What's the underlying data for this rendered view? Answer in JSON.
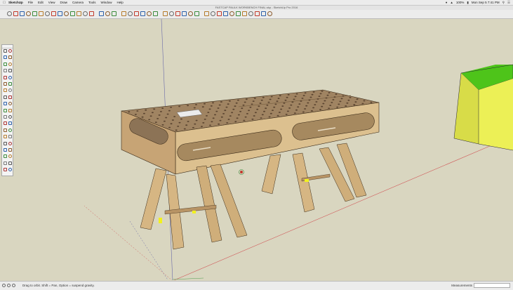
{
  "menubar": {
    "app": "SketchUp",
    "items": [
      "File",
      "Edit",
      "View",
      "Draw",
      "Camera",
      "Tools",
      "Window",
      "Help"
    ],
    "battery": "100%",
    "clock": "Mon Sep 5  7:41 PM"
  },
  "window": {
    "title": "FASTCAP PAULK WORKBENCH FINAL.skp - SketchUp Pro 2016"
  },
  "status": {
    "hint": "Drag to orbit. Shift = Pan, Option = suspend gravity.",
    "measurements_label": "Measurements"
  },
  "colors": {
    "sky": "#d9d6c0",
    "plywood_top": "#a08462",
    "plywood_face": "#c7a475",
    "plywood_edge": "#dcc08f",
    "box_green": "#4ec41a",
    "box_yellow": "#ecf056",
    "red_axis": "#d05a5a",
    "blue_axis": "#5a5a9e",
    "green_axis": "#4f9d4f"
  },
  "toolbar_icons": [
    "select-icon",
    "eraser-icon",
    "line-icon",
    "arc-icon",
    "rectangle-icon",
    "push-pull-icon",
    "move-icon",
    "rotate-icon",
    "scale-icon",
    "offset-icon",
    "tape-icon",
    "text-icon",
    "paint-icon",
    "orbit-icon",
    "pan-icon",
    "zoom-icon",
    "zoom-extents-icon",
    "iso-view-icon",
    "top-view-icon",
    "front-view-icon",
    "right-view-icon",
    "back-view-icon",
    "left-view-icon",
    "xray-icon",
    "wireframe-icon",
    "hidden-line-icon",
    "shaded-icon",
    "textured-icon",
    "monochrome-icon",
    "warehouse-icon",
    "extension-icon",
    "layout-icon",
    "section-icon",
    "shadow-icon",
    "fog-icon",
    "styles-icon",
    "layers-icon",
    "components-icon",
    "materials-icon",
    "scenes-icon"
  ],
  "palette_icons": [
    "select-icon",
    "component-icon",
    "eraser-icon",
    "paint-icon",
    "line-icon",
    "freehand-icon",
    "arc-icon",
    "pie-icon",
    "rectangle-icon",
    "circle-icon",
    "polygon-icon",
    "rotated-rect-icon",
    "push-pull-icon",
    "follow-me-icon",
    "offset-icon",
    "intersect-icon",
    "move-icon",
    "rotate-icon",
    "scale-icon",
    "flip-icon",
    "tape-icon",
    "protractor-icon",
    "dimension-icon",
    "text-icon",
    "axes-icon",
    "3d-text-icon",
    "orbit-icon",
    "pan-icon",
    "zoom-icon",
    "zoom-window-icon",
    "zoom-extents-icon",
    "previous-icon",
    "position-camera-icon",
    "walk-icon",
    "look-around-icon",
    "section-plane-icon",
    "sandbox-icon",
    "drape-icon"
  ]
}
